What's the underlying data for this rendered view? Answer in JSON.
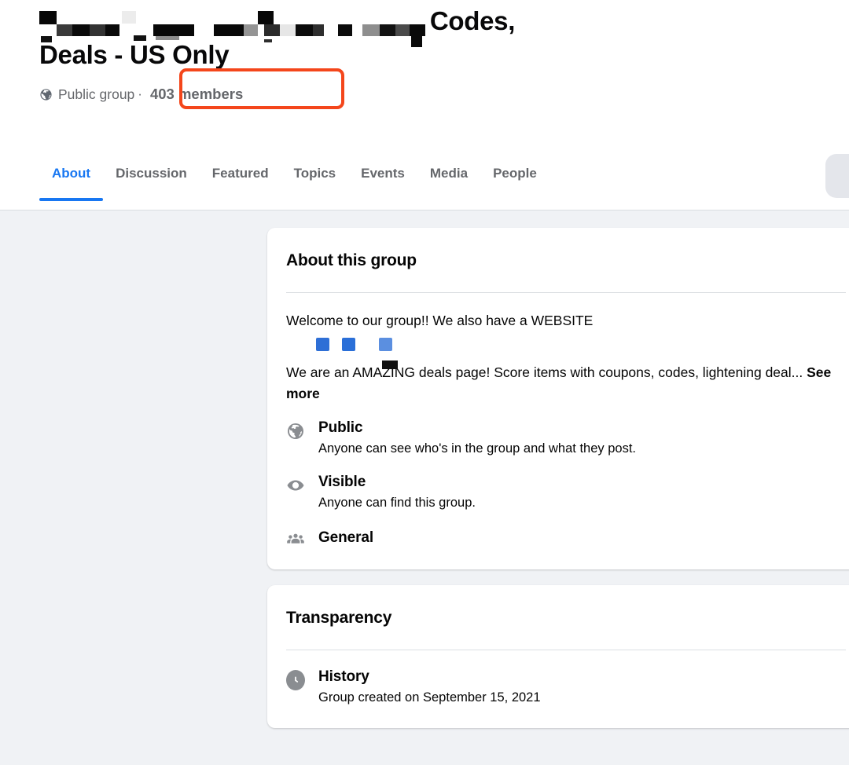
{
  "header": {
    "title_line1_suffix": "Codes,",
    "title_line2": "Deals - US Only",
    "privacy_label": "Public group",
    "separator": "·",
    "members_label": "403 members",
    "globe_icon": "globe-icon",
    "highlight_color": "#F4461B"
  },
  "tabs": [
    {
      "label": "About",
      "active": true
    },
    {
      "label": "Discussion",
      "active": false
    },
    {
      "label": "Featured",
      "active": false
    },
    {
      "label": "Topics",
      "active": false
    },
    {
      "label": "Events",
      "active": false
    },
    {
      "label": "Media",
      "active": false
    },
    {
      "label": "People",
      "active": false
    }
  ],
  "tab_accent_color": "#1877F2",
  "more_button": {
    "icon": "more-horizontal-icon"
  },
  "about_card": {
    "title": "About this group",
    "paragraph1": "Welcome to our group!! We also have a WEBSITE",
    "emoji_colors": [
      "#2E6FD6",
      "#2A6FD8",
      "#5B8FE0"
    ],
    "paragraph2": "We are an AMAZING deals page! Score items with coupons, codes, lightening deal...",
    "see_more": "See more",
    "info": [
      {
        "icon": "globe-icon",
        "head": "Public",
        "sub": "Anyone can see who's in the group and what they post."
      },
      {
        "icon": "eye-icon",
        "head": "Visible",
        "sub": "Anyone can find this group."
      },
      {
        "icon": "people-icon",
        "head": "General",
        "sub": ""
      }
    ]
  },
  "transparency_card": {
    "title": "Transparency",
    "info": [
      {
        "icon": "clock-icon",
        "head": "History",
        "sub": "Group created on September 15, 2021"
      }
    ]
  }
}
